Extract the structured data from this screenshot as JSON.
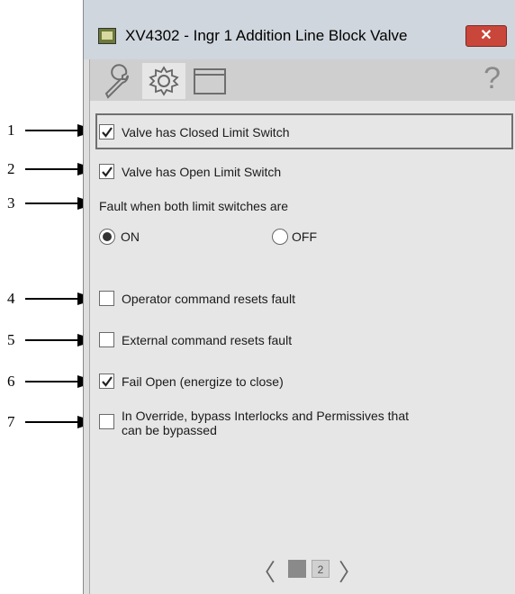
{
  "window": {
    "title": "XV4302 - Ingr 1 Addition Line Block Valve",
    "close_label": "✕"
  },
  "toolbar": {
    "help_label": "?"
  },
  "callouts": [
    "1",
    "2",
    "3",
    "4",
    "5",
    "6",
    "7"
  ],
  "options": {
    "closed_limit": {
      "label": "Valve has Closed Limit Switch",
      "checked": true
    },
    "open_limit": {
      "label": "Valve has Open Limit Switch",
      "checked": true
    },
    "fault_label": "Fault when both limit switches are",
    "on_label": "ON",
    "off_label": "OFF",
    "fault_selected": "ON",
    "operator_reset": {
      "label": "Operator command resets fault",
      "checked": false
    },
    "external_reset": {
      "label": "External command resets fault",
      "checked": false
    },
    "fail_open": {
      "label": "Fail Open (energize to close)",
      "checked": true
    },
    "override_bypass": {
      "label_line1": "In Override, bypass Interlocks and Permissives that",
      "label_line2": "can be bypassed",
      "checked": false
    }
  },
  "pager": {
    "pages": [
      "1",
      "2"
    ],
    "current": "1"
  }
}
